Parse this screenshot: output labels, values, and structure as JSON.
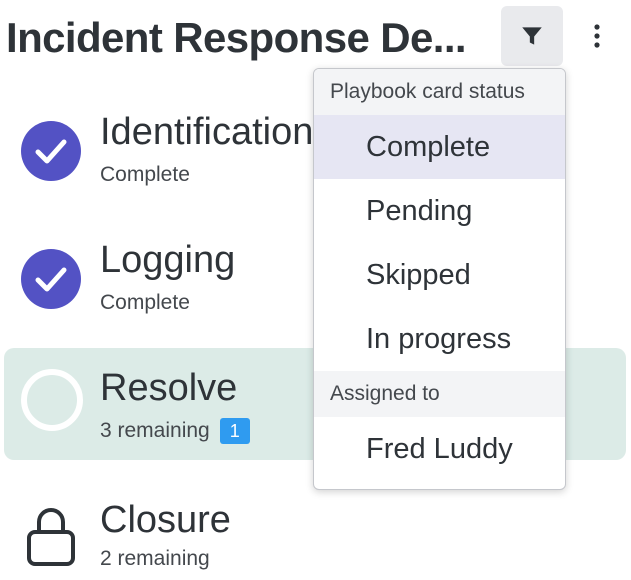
{
  "header": {
    "title": "Incident Response De...",
    "filter_icon": "filter-icon",
    "more_icon": "more-vertical-icon"
  },
  "steps": [
    {
      "name": "Identification",
      "status": "Complete",
      "icon": "check-circle-icon"
    },
    {
      "name": "Logging",
      "status": "Complete",
      "icon": "check-circle-icon"
    },
    {
      "name": "Resolve",
      "status": "3 remaining",
      "badge": "1",
      "icon": "empty-circle-icon",
      "active": true
    },
    {
      "name": "Closure",
      "status": "2 remaining",
      "icon": "lock-icon"
    }
  ],
  "filter_menu": {
    "status_group_label": "Playbook card status",
    "status_options": [
      "Complete",
      "Pending",
      "Skipped",
      "In progress"
    ],
    "highlighted_option": "Complete",
    "assigned_group_label": "Assigned to",
    "assigned_options": [
      "Fred Luddy"
    ]
  },
  "colors": {
    "accent": "#5352c4",
    "active_row": "#dcebe7",
    "badge": "#2f9bf0",
    "text": "#2e3338"
  }
}
